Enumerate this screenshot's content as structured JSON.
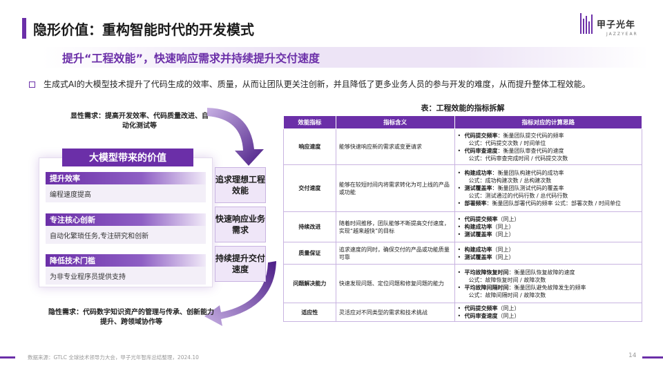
{
  "header": {
    "title": "隐形价值：重构智能时代的开发模式",
    "logo_text": "甲子光年",
    "logo_sub": "JAZZYEAR"
  },
  "subtitle": "提升“工程效能”，快速响应需求并持续提升交付速度",
  "intro": "生成式AI的大模型技术提升了代码生成的效率、质量，从而让团队更关注创新，并且降低了更多业务人员的参与开发的难度，从而提升整体工程效能。",
  "explicit_demand": "显性需求：提高开发效率、代码质量改进、自动化测试等",
  "implicit_demand": "隐性需求：代码数字知识资产的管理与传承、创新能力提升、跨领域协作等",
  "value_box": {
    "heading": "大模型带来的价值",
    "items": [
      {
        "title": "提升效率",
        "desc": "编程速度提高"
      },
      {
        "title": "专注核心创新",
        "desc": "自动化繁琐任务,专注研究和创新"
      },
      {
        "title": "降低技术门槛",
        "desc": "为非专业程序员提供支持"
      }
    ]
  },
  "goals": [
    "追求理想工程效能",
    "快速响应业务需求",
    "持续提升交付速度"
  ],
  "table": {
    "caption": "表：工程效能的指标拆解",
    "headers": [
      "效能指标",
      "指标含义",
      "指标对应的计算思路"
    ],
    "rows": [
      {
        "metric": "响应速度",
        "meaning": "能够快速响应新的需求或变更请求",
        "formulas": [
          {
            "name": "代码提交频率",
            "text": "：衡量团队提交代码的频率",
            "sub": "公式：代码提交次数 / 时间单位"
          },
          {
            "name": "代码审查速度",
            "text": "：衡量团队审查代码的速度",
            "sub": "公式：代码审查完成时间 / 代码提交次数"
          }
        ]
      },
      {
        "metric": "交付速度",
        "meaning": "能够在较短时间内将需求转化为可上线的产品或功能",
        "formulas": [
          {
            "name": "构建成功率",
            "text": "：衡量团队构建代码的成功率",
            "sub": "公式：成功构建次数 / 总构建次数"
          },
          {
            "name": "测试覆盖率",
            "text": "：衡量团队测试代码的覆盖率",
            "sub": "公式：测试通过的代码行数 / 总代码行数"
          },
          {
            "name": "部署频率",
            "text": "：衡量团队部署代码的频率 公式：部署次数 / 时间单位",
            "sub": ""
          }
        ]
      },
      {
        "metric": "持续改进",
        "meaning": "随着时间推移，团队能够不断提高交付速度，实现“越来越快”的目标",
        "formulas": [
          {
            "name": "代码提交频率",
            "text": "（同上）",
            "sub": ""
          },
          {
            "name": "构建成功率",
            "text": "（同上）",
            "sub": ""
          },
          {
            "name": "测试覆盖率",
            "text": "（同上）",
            "sub": ""
          }
        ]
      },
      {
        "metric": "质量保证",
        "meaning": "追求速度的同时，确保交付的产品或功能质量可靠",
        "formulas": [
          {
            "name": "构建成功率",
            "text": "（同上）",
            "sub": ""
          },
          {
            "name": "测试覆盖率",
            "text": "（同上）",
            "sub": ""
          }
        ]
      },
      {
        "metric": "问题解决能力",
        "meaning": "快速发现问题、定位问题和修复问题的能力",
        "formulas": [
          {
            "name": "平均故障恢复时间",
            "text": "：衡量团队恢复故障的速度",
            "sub": "公式：故障恢复时间 / 故障次数"
          },
          {
            "name": "平均故障间隔时间",
            "text": "：衡量团队避免故障发生的频率",
            "sub": "公式：故障间隔时间 / 故障次数"
          }
        ]
      },
      {
        "metric": "适应性",
        "meaning": "灵活应对不同类型的需求和技术挑战",
        "formulas": [
          {
            "name": "代码提交频率",
            "text": "（同上）",
            "sub": ""
          },
          {
            "name": "代码审查速度",
            "text": "（同上）",
            "sub": ""
          }
        ]
      }
    ]
  },
  "footer": {
    "source": "数据来源：GTLC 全球技术领导力大会，甲子光年智库总结整理，2024.10",
    "page": "14"
  },
  "colors": {
    "accent": "#6b2fa8",
    "accent_light": "#efe6f8"
  }
}
